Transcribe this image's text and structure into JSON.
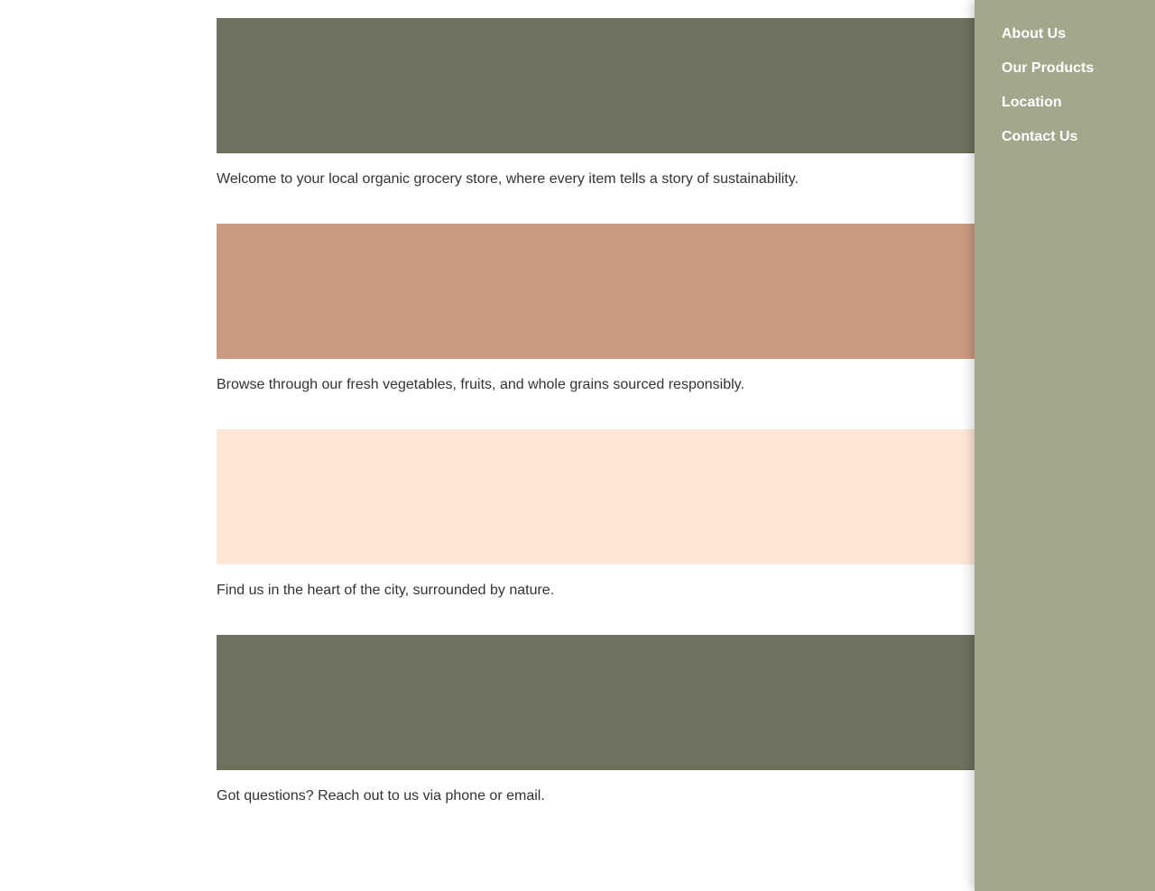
{
  "colors": {
    "sidebar_bg": "#a5a78d",
    "nav_text": "#ffffff",
    "body_text": "#333333",
    "banner_green": "#6c725d",
    "banner_terracotta": "#cb9a7f",
    "banner_peach": "#fee6d5"
  },
  "sections": [
    {
      "banner_color": "#6c725d",
      "text": "Welcome to your local organic grocery store, where every item tells a story of sustainability."
    },
    {
      "banner_color": "#cb9a7f",
      "text": "Browse through our fresh vegetables, fruits, and whole grains sourced responsibly."
    },
    {
      "banner_color": "#fee6d5",
      "text": "Find us in the heart of the city, surrounded by nature."
    },
    {
      "banner_color": "#6c725d",
      "text": "Got questions? Reach out to us via phone or email."
    }
  ],
  "sidebar": {
    "items": [
      {
        "label": "About Us"
      },
      {
        "label": "Our Products"
      },
      {
        "label": "Location"
      },
      {
        "label": "Contact Us"
      }
    ]
  }
}
